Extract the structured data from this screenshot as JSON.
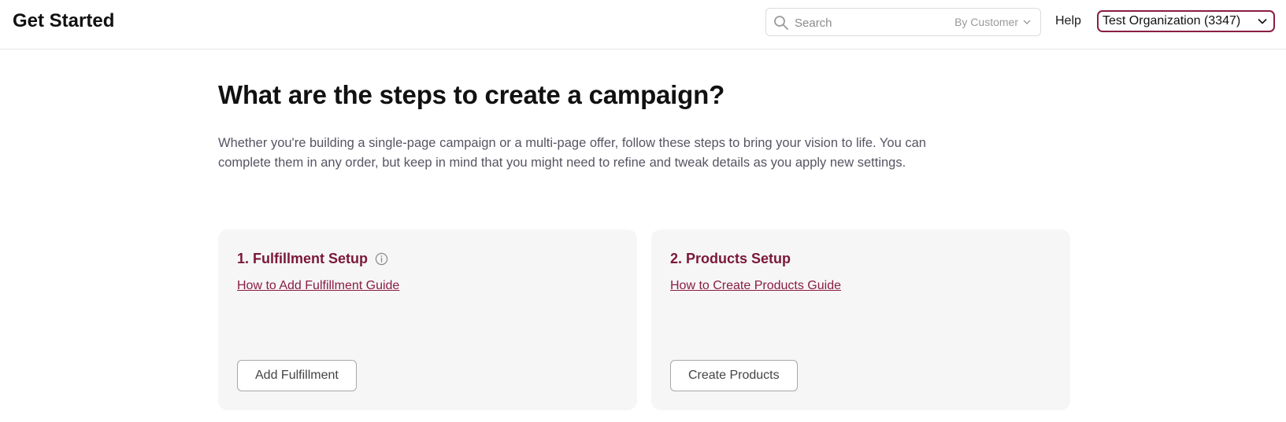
{
  "header": {
    "title": "Get Started",
    "search": {
      "placeholder": "Search",
      "value": "",
      "scope_label": "By Customer"
    },
    "help_label": "Help",
    "organization_label": "Test Organization (3347)"
  },
  "main": {
    "heading": "What are the steps to create a campaign?",
    "intro": "Whether you're building a single-page campaign or a multi-page offer, follow these steps to bring your vision to life. You can complete them in any order, but keep in mind that you might need to refine and tweak details as you apply new settings.",
    "steps": [
      {
        "title": "1. Fulfillment Setup",
        "has_info_icon": true,
        "guide_link": "How to Add Fulfillment Guide",
        "button_label": "Add Fulfillment"
      },
      {
        "title": "2. Products Setup",
        "has_info_icon": false,
        "guide_link": "How to Create Products Guide",
        "button_label": "Create Products"
      }
    ]
  },
  "colors": {
    "accent": "#8a1d45",
    "card_title": "#7a1838",
    "card_background": "#f6f6f6",
    "body_text": "#585463"
  },
  "icons": {
    "search": "search-icon",
    "scope_dropdown": "chevron-down-icon",
    "org_dropdown": "chevron-down-icon",
    "info": "info-icon"
  }
}
